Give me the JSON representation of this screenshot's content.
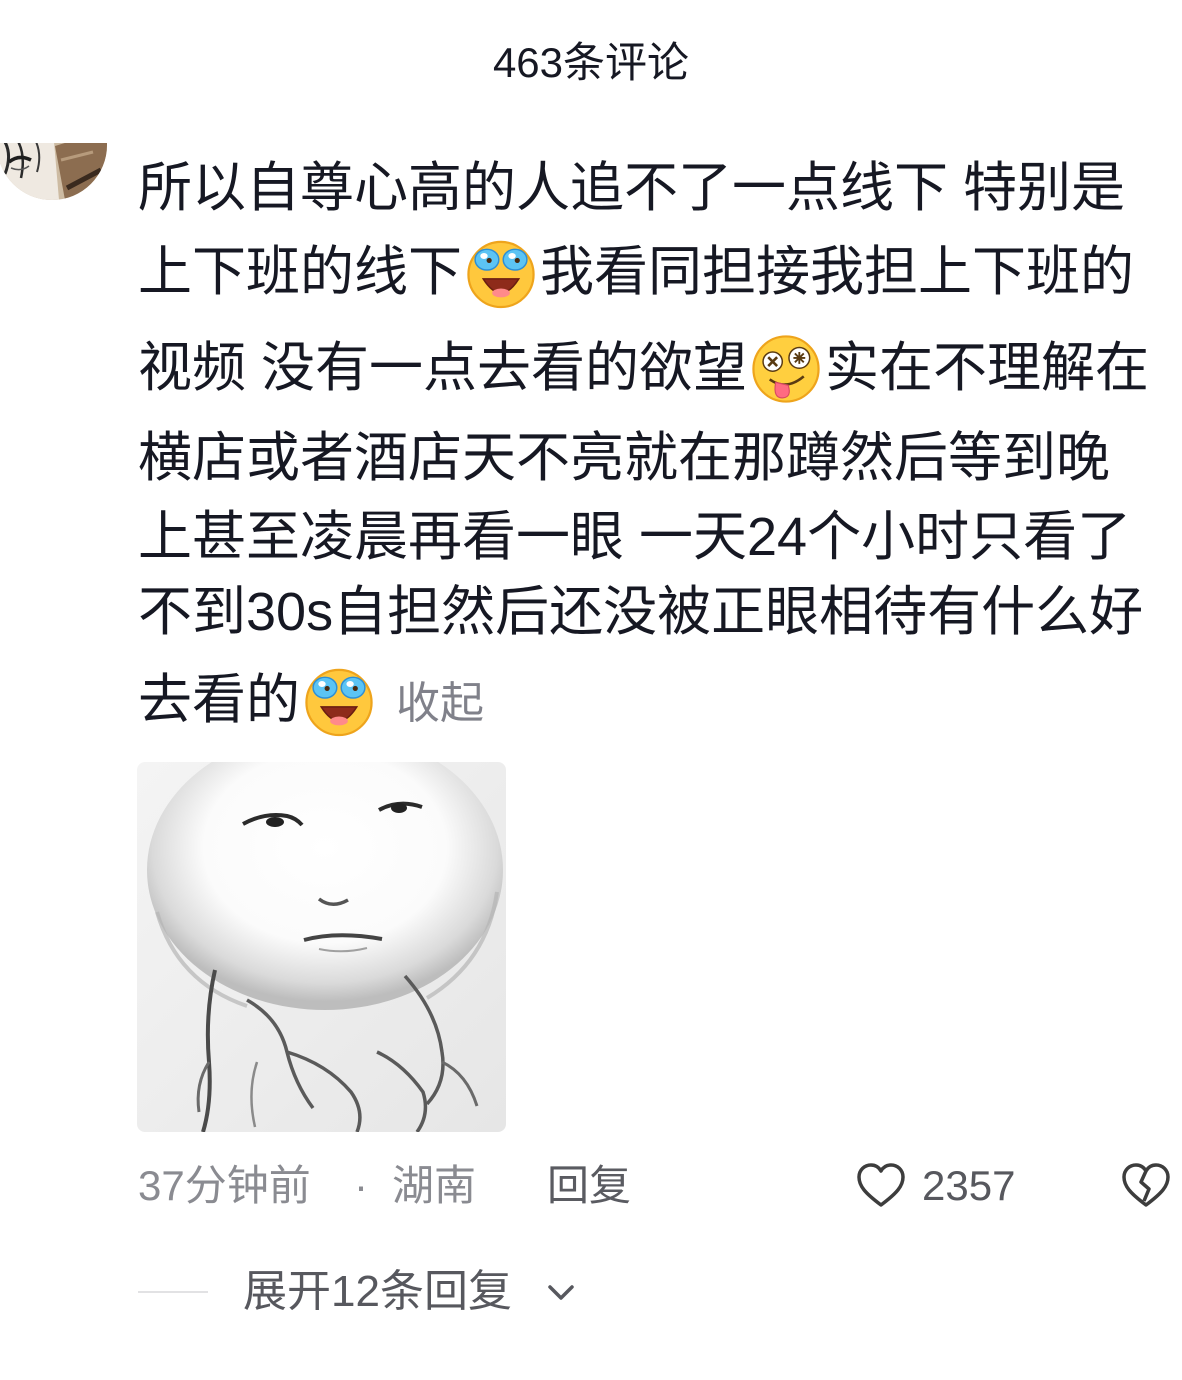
{
  "header": {
    "title": "463条评论"
  },
  "comment": {
    "avatar_icon": "user-avatar",
    "lines": [
      {
        "a": "所以自尊心高的人追不了一点线下 特别是"
      },
      {
        "a": "上下班的线下",
        "emoji": "laughing-crying-emoji",
        "b": "我看同担接我担上下班的"
      },
      {
        "a": "视频 没有一点去看的欲望",
        "emoji": "zany-face-emoji",
        "b": "实在不理解在"
      },
      {
        "a": "横店或者酒店天不亮就在那蹲然后等到晚"
      },
      {
        "a": "上甚至凌晨再看一眼 一天24个小时只看了"
      },
      {
        "a": "不到30s自担然后还没被正眼相待有什么好"
      },
      {
        "a": "去看的",
        "emoji": "laughing-crying-emoji"
      }
    ],
    "collapse_label": "收起",
    "image_icon": "meme-sticker-image",
    "meta": {
      "time": "37分钟前",
      "separator": "·",
      "location": "湖南",
      "reply_label": "回复",
      "like_icon": "heart-outline-icon",
      "like_count": "2357",
      "dislike_icon": "broken-heart-icon"
    }
  },
  "replies": {
    "expand_label": "展开12条回复",
    "expand_icon": "chevron-down-icon"
  },
  "colors": {
    "background": "#ffffff",
    "text_primary": "#161823",
    "text_secondary": "#8a8b91",
    "emoji_yellow": "#ffc83d"
  }
}
